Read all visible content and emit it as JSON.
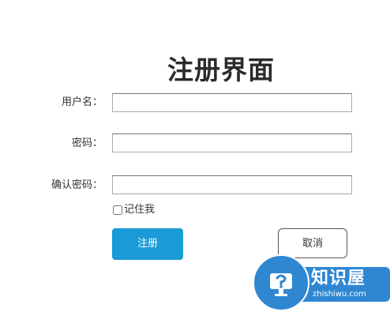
{
  "form": {
    "title": "注册界面",
    "username_label": "用户名：",
    "username_value": "",
    "password_label": "密码：",
    "password_value": "",
    "confirm_label": "确认密码：",
    "confirm_value": "",
    "remember_label": "记住我",
    "remember_checked": false,
    "submit_label": "注册",
    "cancel_label": "取消"
  },
  "watermark": {
    "title": "知识屋",
    "subtitle": "zhishiwu.com"
  },
  "colors": {
    "primary_button": "#1a9ad6",
    "watermark_blue": "#2f87d1"
  }
}
